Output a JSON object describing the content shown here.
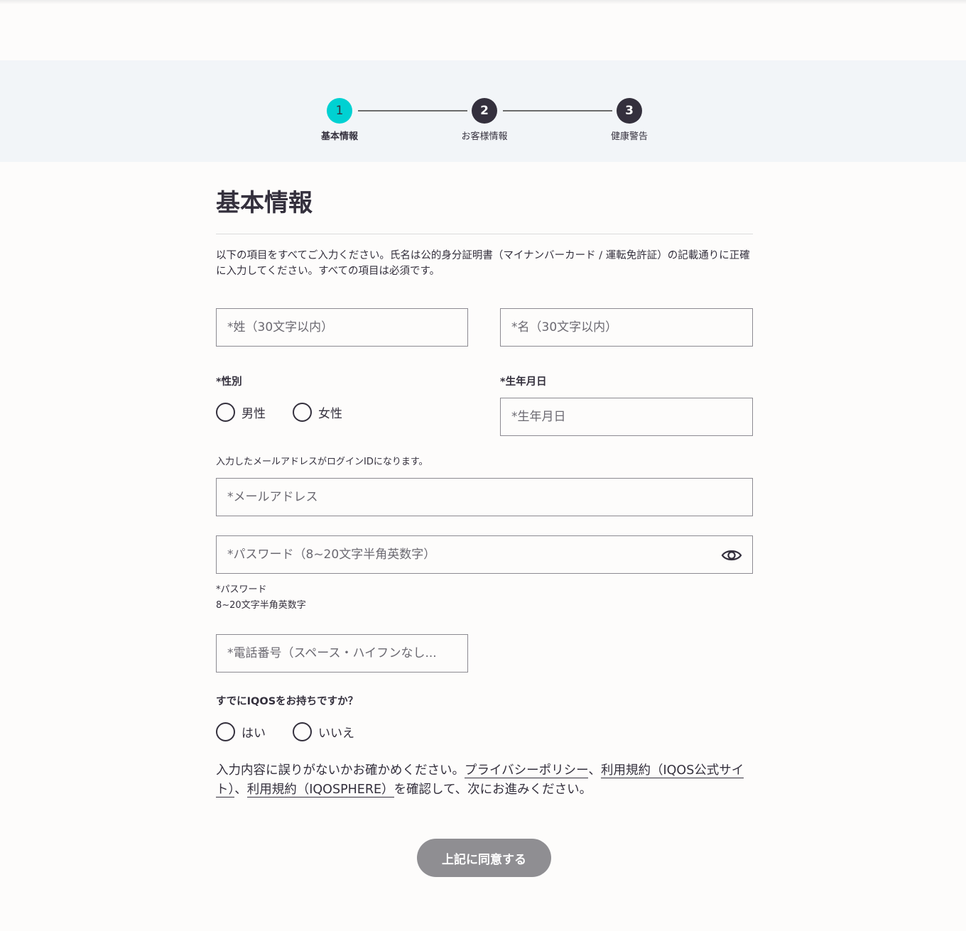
{
  "stepper": {
    "steps": [
      {
        "number": "1",
        "label": "基本情報"
      },
      {
        "number": "2",
        "label": "お客様情報"
      },
      {
        "number": "3",
        "label": "健康警告"
      }
    ],
    "active_color": "#00d1d2",
    "inactive_color": "#34303d"
  },
  "page": {
    "title": "基本情報",
    "intro": "以下の項目をすべてご入力ください。氏名は公的身分証明書（マイナンバーカード / 運転免許証）の記載通りに正確に入力してください。すべての項目は必須です。"
  },
  "form": {
    "last_name_placeholder": "*姓（30文字以内）",
    "first_name_placeholder": "*名（30文字以内）",
    "gender_label": "*性別",
    "gender_options": [
      "男性",
      "女性"
    ],
    "birthdate_label": "*生年月日",
    "birthdate_placeholder": "*生年月日",
    "email_note": "入力したメールアドレスがログインIDになります。",
    "email_placeholder": "*メールアドレス",
    "password_placeholder": "*パスワード（8~20文字半角英数字）",
    "password_hint_title": "*パスワード",
    "password_hint_rule": "8~20文字半角英数字",
    "phone_placeholder": "*電話番号（スペース・ハイフンなし...",
    "iqos_question": "すでにIQOSをお持ちですか？",
    "iqos_options": [
      "はい",
      "いいえ"
    ]
  },
  "consent": {
    "prefix": "入力内容に誤りがないかお確かめください。",
    "link_privacy": "プライバシーポリシー",
    "sep1": "、",
    "link_terms_site": "利用規約（IQOS公式サイト）",
    "sep2": "、",
    "link_terms_iqosphere": "利用規約（IQOSPHERE）",
    "suffix": "を確認して、次にお進みください。"
  },
  "actions": {
    "agree_label": "上記に同意する"
  }
}
